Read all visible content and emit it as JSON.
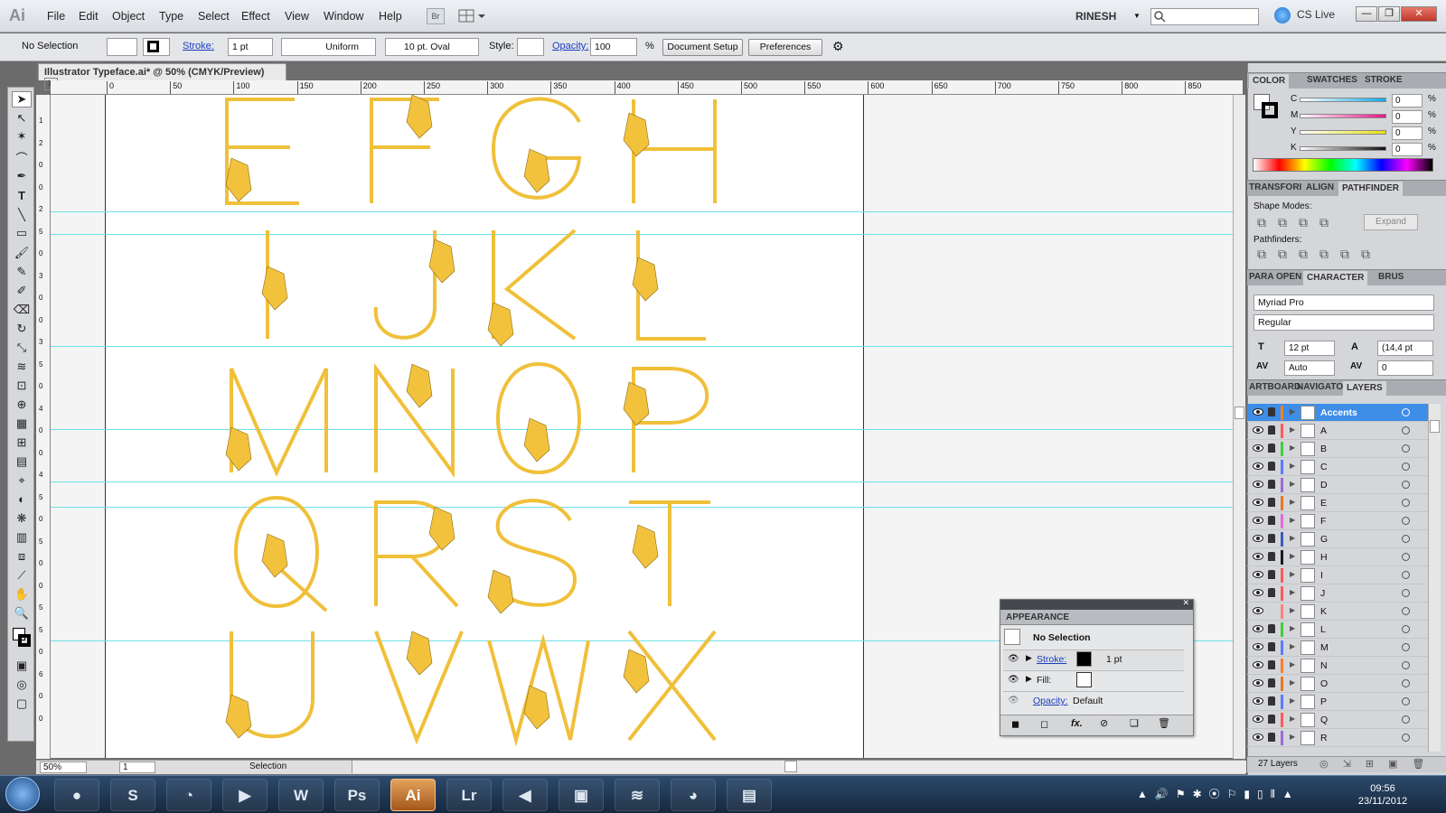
{
  "app": {
    "logo": "Ai"
  },
  "menu": {
    "items": [
      "File",
      "Edit",
      "Object",
      "Type",
      "Select",
      "Effect",
      "View",
      "Window",
      "Help"
    ],
    "br": "Br",
    "user": "RINESH",
    "cslive": "CS Live"
  },
  "control": {
    "selection": "No Selection",
    "stroke_label": "Stroke:",
    "stroke_value": "1 pt",
    "profile": "Uniform",
    "brush": "10 pt. Oval",
    "style_label": "Style:",
    "opacity_label": "Opacity:",
    "opacity_value": "100",
    "opacity_unit": "%",
    "doc_setup": "Document Setup",
    "preferences": "Preferences"
  },
  "document": {
    "tab_title": "Illustrator Typeface.ai* @ 50% (CMYK/Preview)",
    "zoom": "50%",
    "artboard_num": "1",
    "status": "Selection",
    "ruler_labels": [
      "0",
      "50",
      "100",
      "150",
      "200",
      "250",
      "300",
      "350",
      "400",
      "450",
      "500",
      "550",
      "600",
      "650",
      "700",
      "750",
      "800",
      "850"
    ],
    "vruler_labels": [
      "1",
      "2",
      "0",
      "0",
      "2",
      "5",
      "0",
      "3",
      "0",
      "0",
      "3",
      "5",
      "0",
      "4",
      "0",
      "0",
      "4",
      "5",
      "0",
      "5",
      "0",
      "0",
      "5",
      "5",
      "0",
      "6",
      "0",
      "0"
    ]
  },
  "glyphs": [
    "E",
    "F",
    "G",
    "H",
    "I",
    "J",
    "K",
    "L",
    "M",
    "N",
    "O",
    "P",
    "Q",
    "R",
    "S",
    "T",
    "U",
    "V",
    "W",
    "X"
  ],
  "colors": {
    "glyph": "#f0c03a",
    "guide": "#6fe0e8",
    "selection": "#3e8ee8"
  },
  "color_panel": {
    "tabs": [
      "COLOR",
      "SWATCHES",
      "STROKE"
    ],
    "channels": [
      {
        "name": "C",
        "value": "0",
        "unit": "%"
      },
      {
        "name": "M",
        "value": "0",
        "unit": "%"
      },
      {
        "name": "Y",
        "value": "0",
        "unit": "%"
      },
      {
        "name": "K",
        "value": "0",
        "unit": "%"
      }
    ]
  },
  "pathfinder_panel": {
    "tabs": [
      "TRANSFORI",
      "ALIGN",
      "PATHFINDER"
    ],
    "shape_modes": "Shape Modes:",
    "pathfinders": "Pathfinders:",
    "expand": "Expand"
  },
  "character_panel": {
    "tabs": [
      "PARA",
      "OPEN",
      "CHARACTER",
      "BRUS"
    ],
    "font": "Myriad Pro",
    "style": "Regular",
    "size": "12 pt",
    "leading": "(14,4 pt",
    "kerning": "Auto",
    "tracking": "0"
  },
  "layers_panel": {
    "tabs": [
      "ARTBOARD",
      "NAVIGATO",
      "LAYERS"
    ],
    "layers": [
      {
        "name": "Accents",
        "color": "#ff7f2a"
      },
      {
        "name": "A",
        "color": "#ff5a5a"
      },
      {
        "name": "B",
        "color": "#3fcf3f"
      },
      {
        "name": "C",
        "color": "#5a7cff"
      },
      {
        "name": "D",
        "color": "#9a6ad8"
      },
      {
        "name": "E",
        "color": "#e8762a"
      },
      {
        "name": "F",
        "color": "#e06ad8"
      },
      {
        "name": "G",
        "color": "#3b5cbf"
      },
      {
        "name": "H",
        "color": "#1a1a1a"
      },
      {
        "name": "I",
        "color": "#ff5a5a"
      },
      {
        "name": "J",
        "color": "#ff5a5a"
      },
      {
        "name": "K",
        "color": "#ff8080"
      },
      {
        "name": "L",
        "color": "#3fcf3f"
      },
      {
        "name": "M",
        "color": "#5a7cff"
      },
      {
        "name": "N",
        "color": "#ff7f2a"
      },
      {
        "name": "O",
        "color": "#e8762a"
      },
      {
        "name": "P",
        "color": "#5a7cff"
      },
      {
        "name": "Q",
        "color": "#ff5a5a"
      },
      {
        "name": "R",
        "color": "#9a6ad8"
      }
    ],
    "count": "27 Layers"
  },
  "appearance_panel": {
    "title": "APPEARANCE",
    "heading": "No Selection",
    "stroke_label": "Stroke:",
    "stroke_value": "1 pt",
    "fill_label": "Fill:",
    "opacity_label": "Opacity:",
    "opacity_value": "Default",
    "fx": "fx."
  },
  "taskbar": {
    "apps": [
      "Chrome",
      "Skype",
      "Lync",
      "Media",
      "Word",
      "Ps",
      "Ai",
      "Lr",
      "Volume",
      "Network",
      "Spotify",
      "Paint",
      "Explorer"
    ],
    "time": "09:56",
    "date": "23/11/2012"
  }
}
